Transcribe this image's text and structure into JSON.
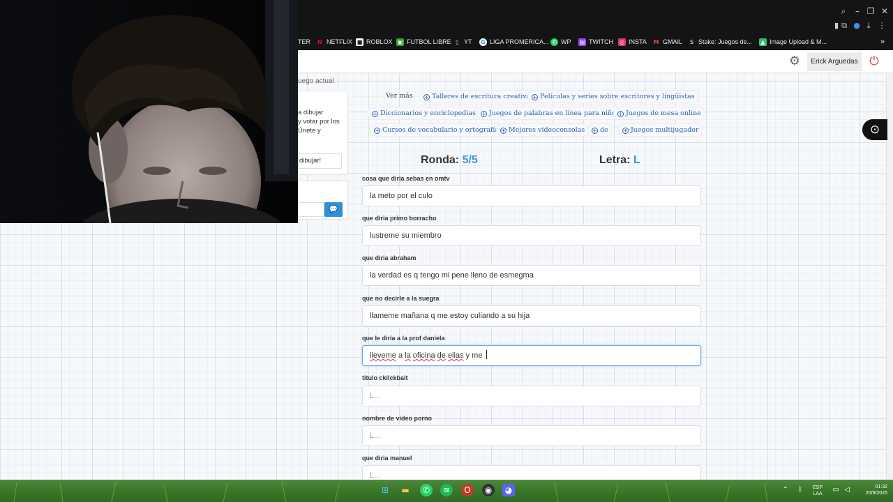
{
  "bookmarks": [
    {
      "label": "TER",
      "icon": "bookmark-icon"
    },
    {
      "label": "NETFLIX",
      "icon": "netflix-icon"
    },
    {
      "label": "ROBLOX",
      "icon": "roblox-icon"
    },
    {
      "label": "FUTBOL LIBRE",
      "icon": "futbol-icon"
    },
    {
      "label": "YT",
      "icon": "page-icon"
    },
    {
      "label": "LIGA PROMERICA...",
      "icon": "google-icon"
    },
    {
      "label": "WP",
      "icon": "whatsapp-icon"
    },
    {
      "label": "TWITCH",
      "icon": "twitch-icon"
    },
    {
      "label": "INSTA",
      "icon": "instagram-icon"
    },
    {
      "label": "GMAIL",
      "icon": "gmail-icon"
    },
    {
      "label": "Stake: Juegos de...",
      "icon": "stake-icon"
    },
    {
      "label": "Image Upload & M...",
      "icon": "image-upload-icon"
    }
  ],
  "header": {
    "user_name": "Erick Arguedas"
  },
  "left_panel": {
    "game_label": "uego actual",
    "card_text_1": "a dibujar",
    "card_text_2": "y votar por los",
    "card_text_3": "Únete y",
    "draw_field_value": "dibujar!"
  },
  "related": {
    "ver_mas": "Ver más",
    "items": [
      "Talleres de escritura creativa",
      "Películas y series sobre escritores y lingüistas",
      "Diccionarios y enciclopedias",
      "Juegos de palabras en línea para niños",
      "Juegos de mesa online",
      "Cursos de vocabulario y ortografía",
      "Mejores videoconsolas",
      "de",
      "Juegos multijugador"
    ]
  },
  "round": {
    "round_label": "Ronda:",
    "round_value": "5/5",
    "letter_label": "Letra:",
    "letter_value": "L"
  },
  "questions": [
    {
      "label": "cosa que diria sebas en omtv",
      "answer": "la meto por el culo"
    },
    {
      "label": "que diria primo borracho",
      "answer": "lustreme su miembro"
    },
    {
      "label": "que diria abraham",
      "answer": "la verdad es q tengo mi pene lleno de esmegma"
    },
    {
      "label": "que no decirle a la suegra",
      "answer": "llameme mañana q me estoy culiando a su hija"
    },
    {
      "label": "que le diria a la prof daniela",
      "answer_parts": [
        "lleveme",
        " a ",
        "la",
        " ",
        "oficina",
        " ",
        "de",
        " ",
        "elias",
        " y me "
      ]
    },
    {
      "label": "titulo ckilckbait",
      "placeholder": "L..."
    },
    {
      "label": "nombre de video porno",
      "placeholder": "L..."
    },
    {
      "label": "que diria manuel",
      "placeholder": "L..."
    }
  ],
  "tray": {
    "lang_1": "ESP",
    "lang_2": "LAA",
    "time": "01:32",
    "date": "20/9/2025"
  }
}
